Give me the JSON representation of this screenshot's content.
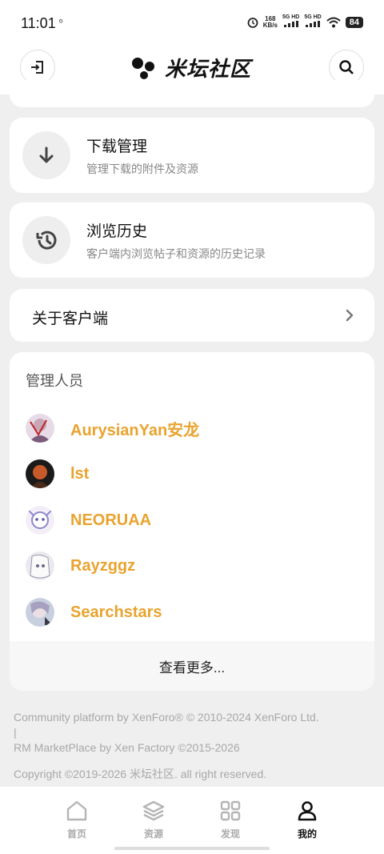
{
  "status_bar": {
    "time": "11:01",
    "notification_glyph": "ᵒ",
    "speed_value": "168",
    "speed_unit": "KB/s",
    "sim1": "5G HD",
    "sim2": "5G HD",
    "battery": "84"
  },
  "header": {
    "logo_text": "米坛社区",
    "login_icon": "login-icon",
    "search_icon": "search-icon"
  },
  "menu": {
    "downloads": {
      "title": "下载管理",
      "subtitle": "管理下载的附件及资源",
      "icon": "download-icon"
    },
    "history": {
      "title": "浏览历史",
      "subtitle": "客户端内浏览帖子和资源的历史记录",
      "icon": "history-icon"
    },
    "about": {
      "label": "关于客户端",
      "icon": "chevron-right-icon"
    }
  },
  "admins": {
    "title": "管理人员",
    "members": [
      {
        "name": "AurysianYan安龙"
      },
      {
        "name": "lst"
      },
      {
        "name": "NEORUAA"
      },
      {
        "name": "Rayzggz"
      },
      {
        "name": "Searchstars"
      }
    ],
    "more_label": "查看更多..."
  },
  "footer": {
    "line1": "Community platform by XenForo® © 2010-2024 XenForo Ltd.",
    "separator": "|",
    "line2": "RM MarketPlace by Xen Factory ©2015-2026",
    "line3": "Copyright ©2019-2026 米坛社区. all right reserved."
  },
  "tabbar": {
    "tabs": [
      {
        "label": "首页",
        "icon": "home-icon"
      },
      {
        "label": "资源",
        "icon": "layers-icon"
      },
      {
        "label": "发现",
        "icon": "grid-icon"
      },
      {
        "label": "我的",
        "icon": "user-icon"
      }
    ],
    "active_index": 3
  },
  "colors": {
    "accent": "#e9a32e",
    "card_background": "#ffffff",
    "page_background": "#efefef"
  }
}
